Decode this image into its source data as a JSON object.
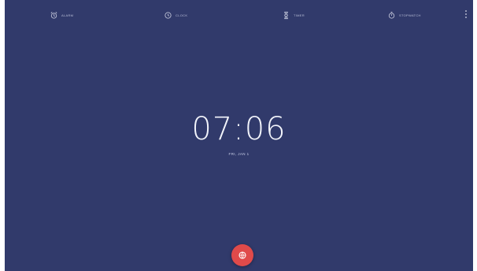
{
  "tabs": [
    {
      "id": "alarm",
      "label": "Alarm",
      "icon": "alarm-icon"
    },
    {
      "id": "clock",
      "label": "Clock",
      "icon": "clock-icon"
    },
    {
      "id": "timer",
      "label": "Timer",
      "icon": "hourglass-icon"
    },
    {
      "id": "stopwatch",
      "label": "Stopwatch",
      "icon": "stopwatch-icon"
    }
  ],
  "overflow_menu": {
    "icon": "more-vert-icon"
  },
  "clock": {
    "time": "07:06",
    "date": "Fri, Jan 1"
  },
  "fab": {
    "icon": "world-clock-icon",
    "color": "#e04a4a"
  },
  "colors": {
    "background": "#313a6b",
    "text": "#f2f4fb",
    "accent": "#e04a4a"
  }
}
